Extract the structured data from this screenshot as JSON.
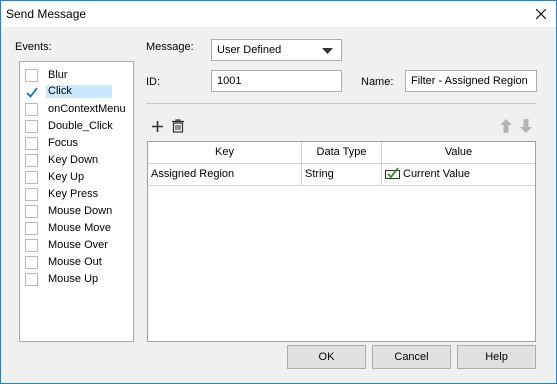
{
  "window": {
    "title": "Send Message"
  },
  "events": {
    "label": "Events:",
    "items": [
      {
        "label": "Blur",
        "checked": false
      },
      {
        "label": "Click",
        "checked": true
      },
      {
        "label": "onContextMenu",
        "checked": false
      },
      {
        "label": "Double_Click",
        "checked": false
      },
      {
        "label": "Focus",
        "checked": false
      },
      {
        "label": "Key Down",
        "checked": false
      },
      {
        "label": "Key Up",
        "checked": false
      },
      {
        "label": "Key Press",
        "checked": false
      },
      {
        "label": "Mouse Down",
        "checked": false
      },
      {
        "label": "Mouse Move",
        "checked": false
      },
      {
        "label": "Mouse Over",
        "checked": false
      },
      {
        "label": "Mouse Out",
        "checked": false
      },
      {
        "label": "Mouse Up",
        "checked": false
      }
    ]
  },
  "form": {
    "message_label": "Message:",
    "message_value": "User Defined",
    "id_label": "ID:",
    "id_value": "1001",
    "name_label": "Name:",
    "name_value": "Filter - Assigned Region"
  },
  "grid": {
    "columns": [
      "Key",
      "Data Type",
      "Value"
    ],
    "rows": [
      {
        "key": "Assigned Region",
        "type": "String",
        "value": "Current Value"
      }
    ]
  },
  "buttons": {
    "ok": "OK",
    "cancel": "Cancel",
    "help": "Help"
  },
  "colors": {
    "accent": "#1883d7",
    "selection": "#cce8ff",
    "check": "#1a73c9"
  }
}
